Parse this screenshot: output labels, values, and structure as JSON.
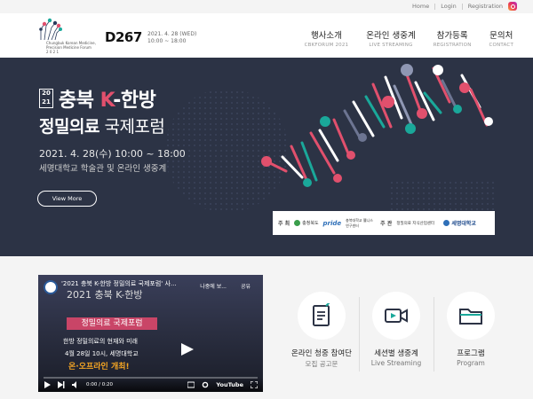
{
  "topbar": {
    "links": [
      "Home",
      "Login",
      "Registration"
    ]
  },
  "header": {
    "logo_lines": [
      "Chungbuk Korean Medicine,",
      "Precision Medicine Forum",
      "2 0 2 1"
    ],
    "dday": "D267",
    "date_line1": "2021. 4. 28 (WED)",
    "date_line2": "10:00 ~ 18:00",
    "nav": [
      {
        "ko": "행사소개",
        "en": "CBKFORUM 2021"
      },
      {
        "ko": "온라인 생중계",
        "en": "LIVE STREAMING"
      },
      {
        "ko": "참가등록",
        "en": "REGISTRATION"
      },
      {
        "ko": "문의처",
        "en": "CONTACT"
      }
    ]
  },
  "hero": {
    "year_top": "20",
    "year_bottom": "21",
    "title_prefix": "충북 ",
    "title_k": "K",
    "title_suffix": "-한방",
    "title2_bold": "정밀의료",
    "title2_rest": " 국제포럼",
    "date": "2021. 4. 28(수) 10:00 ~ 18:00",
    "venue": "세명대학교 학술관 및 온라인 생중계",
    "view_more": "View More",
    "sponsor": {
      "host_label": "주 최",
      "host_org": "충청북도",
      "pride": "pride",
      "pride_caption": "충북대학교 웰니스연구센터",
      "organizer_label": "주 관",
      "organizer_org": "정밀의료 지식산업센터",
      "univ": "세명대학교"
    }
  },
  "video": {
    "title": "'2021 충북 K-한방 정밀의료 국제포럼' 사...",
    "overlay_title": "2021 충북 K-한방",
    "watch_later": "나중에 보...",
    "share": "공유",
    "band": "정밀의료 국제포럼",
    "line1": "한방 정밀의료의 현재와 미래",
    "line2": "4월 28일 10시, 세명대학교",
    "line3": "온·오프라인 개최!",
    "time": "0:00 / 0:20",
    "brand": "YouTube"
  },
  "quick_links": [
    {
      "ko": "온라인 청중 참여단",
      "sub": "모집 공고문"
    },
    {
      "ko": "세션별 생중계",
      "sub": "Live Streaming"
    },
    {
      "ko": "프로그램",
      "sub": "Program"
    }
  ],
  "colors": {
    "hero_bg": "#2c3345",
    "accent_pink": "#e1506d",
    "teal": "#1aa89a"
  }
}
